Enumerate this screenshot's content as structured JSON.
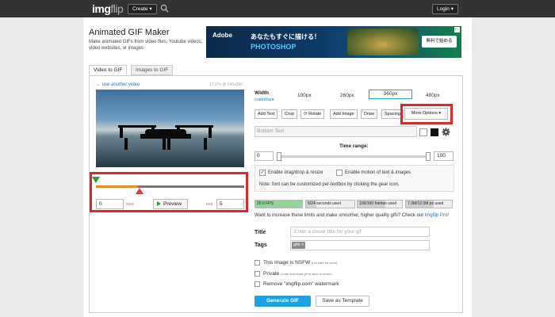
{
  "header": {
    "logo_main": "img",
    "logo_flip": "flip",
    "create_label": "Create ▾",
    "login_label": "Login ▾"
  },
  "page": {
    "title": "Animated GIF Maker",
    "description": "Make animated GIFs from video files, Youtube videos, video websites, or images"
  },
  "ad": {
    "brand": "Adobe",
    "headline": "あなたもすぐに描ける！",
    "product": "PHOTOSHOP",
    "cta": "無料で始める"
  },
  "tabs": [
    {
      "label": "Video to GIF",
      "active": true
    },
    {
      "label": "Images to GIF",
      "active": false
    }
  ],
  "video": {
    "use_another": "← use another video",
    "meta": "17.27s @ 640x360"
  },
  "trim": {
    "start_value": "0",
    "start_label": "start",
    "end_value": "5",
    "end_label": "end",
    "preview_label": "Preview",
    "start_color": "#2a9d3c",
    "end_color": "#e03a3a",
    "selection_color": "#f08a24"
  },
  "width": {
    "label": "Width",
    "customize": "customize",
    "options": [
      "100px",
      "260px",
      "360px",
      "480px"
    ],
    "selected": "360px"
  },
  "toolbar": {
    "add_text": "Add Text",
    "crop": "Crop",
    "rotate": "⟳ Rotate",
    "add_image": "Add Image",
    "draw": "Draw",
    "spacing": "Spacing",
    "more_options": "More Options ▾"
  },
  "textbox": {
    "placeholder": "Bottom Text"
  },
  "time_range": {
    "label": "Time range:",
    "start": "0",
    "end": "100"
  },
  "options": {
    "drag_drop": "Enable drag/drop & resize",
    "drag_drop_checked": true,
    "motion": "Enable motion of text & images",
    "motion_checked": false,
    "font_note": "Note: font can be customized per-textbox by clicking the gear icon."
  },
  "stats": [
    {
      "label": "20.0 FPS",
      "fill": 1.0
    },
    {
      "label": "5/24 seconds used",
      "fill": 0.21
    },
    {
      "label": "100/160 frames used",
      "fill": 0.63
    },
    {
      "label": "7.3M/12.0M px used",
      "fill": 0.61
    }
  ],
  "upgrade": {
    "text": "Want to increase these limits and make smoother, higher quality gifs? Check out ",
    "link": "Imgflip Pro",
    "suffix": "!"
  },
  "form": {
    "title_label": "Title",
    "title_placeholder": "Enter a clever title for your gif",
    "tags_label": "Tags",
    "tag_chip": "gifs ×"
  },
  "checkboxes": {
    "nsfw": "This image is NSFW",
    "nsfw_note": "(not safe for work)",
    "private": "Private",
    "private_note": "(must download gif to save or share)",
    "watermark": "Remove \"imgflip.com\" watermark"
  },
  "actions": {
    "generate": "Generate GIF",
    "save_template": "Save as Template"
  }
}
